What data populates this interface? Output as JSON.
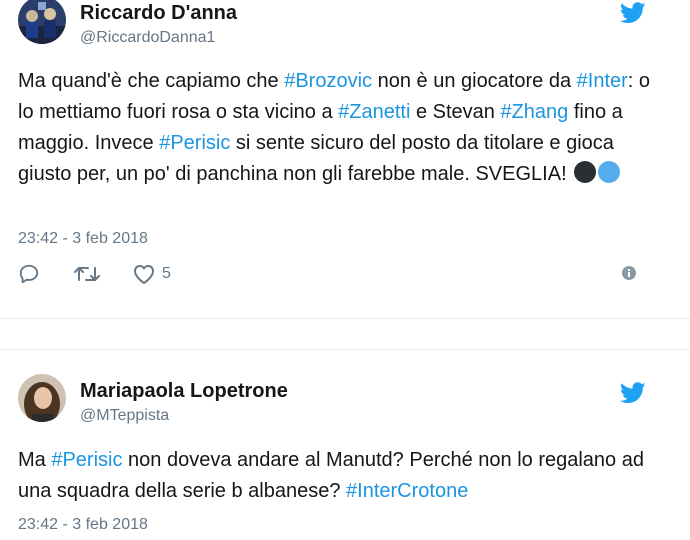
{
  "tweets": [
    {
      "name": "Riccardo D'anna",
      "handle": "@RiccardoDanna1",
      "text_parts": [
        "Ma quand'è che capiamo che ",
        "#Brozovic",
        " non è un giocatore da ",
        "#Inter",
        ": o lo mettiamo fuori rosa o sta vicino a ",
        "#Zanetti",
        " e Stevan ",
        "#Zhang",
        " fino a maggio. Invece ",
        "#Perisic",
        " si sente sicuro del posto da titolare e gioca giusto per, un po' di panchina non gli farebbe male. SVEGLIA! "
      ],
      "emoji_colors": [
        "#292f33",
        "#55acee"
      ],
      "timestamp": "23:42 - 3 feb 2018",
      "like_count": "5"
    },
    {
      "name": "Mariapaola Lopetrone",
      "handle": "@MTeppista",
      "text_parts": [
        "Ma ",
        "#Perisic",
        " non doveva andare al Manutd? Perché non lo regalano ad una squadra della serie b albanese? ",
        "#InterCrotone"
      ],
      "timestamp": "23:42 - 3 feb 2018"
    }
  ],
  "colors": {
    "hashtag": "#1b95e0",
    "twitter_blue": "#1da1f2",
    "meta_gray": "#657786",
    "text": "#14171a"
  },
  "icons": {
    "brand": "twitter-bird-icon",
    "reply": "reply-icon",
    "retweet": "retweet-icon",
    "like": "heart-icon",
    "info": "info-icon"
  }
}
